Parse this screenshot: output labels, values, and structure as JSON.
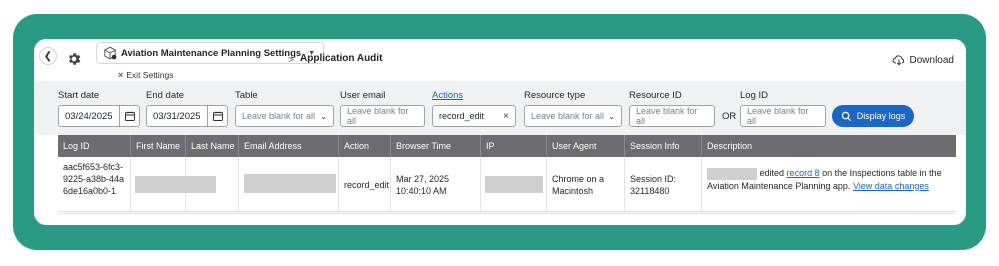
{
  "header": {
    "app_dropdown_label": "Aviation Maintenance Planning Settings",
    "exit_label": "Exit Settings",
    "breadcrumb_sep": ">",
    "page_title": "Application Audit",
    "download_label": "Download"
  },
  "filters": {
    "start_date_label": "Start date",
    "start_date_value": "03/24/2025",
    "end_date_label": "End date",
    "end_date_value": "03/31/2025",
    "table_label": "Table",
    "table_placeholder": "Leave blank for all",
    "user_email_label": "User email",
    "user_email_placeholder": "Leave blank for all",
    "actions_label": "Actions",
    "actions_value": "record_edit",
    "resource_type_label": "Resource type",
    "resource_type_placeholder": "Leave blank for all",
    "resource_id_label": "Resource ID",
    "resource_id_placeholder": "Leave blank for all",
    "or_label": "OR",
    "log_id_label": "Log ID",
    "log_id_placeholder": "Leave blank for all",
    "display_button": "Display logs"
  },
  "table": {
    "columns": [
      "Log ID",
      "First Name",
      "Last Name",
      "Email Address",
      "Action",
      "Browser Time",
      "IP",
      "User Agent",
      "Session Info",
      "Description"
    ],
    "rows": [
      {
        "log_id": "aac5f653-6fc3-9225-a38b-44a6de16a0b0-1",
        "first_name": "",
        "last_name": "",
        "email": "",
        "action": "record_edit",
        "browser_time": "Mar 27, 2025 10:40:10 AM",
        "ip": "",
        "user_agent": "Chrome on a Macintosh",
        "session_info": "Session ID: 32118480",
        "description_pre": "edited",
        "description_link": "record 8",
        "description_mid": "on the Inspections table in the Aviation Maintenance Planning app.",
        "description_link2": "View data changes"
      }
    ]
  },
  "icons": {
    "back": "chevron-left-icon",
    "settings": "gear-icon",
    "app": "app-cube-icon",
    "download": "cloud-download-icon",
    "calendar": "calendar-icon",
    "search": "search-icon"
  },
  "colors": {
    "frame": "#2b9a84",
    "primary": "#1a66c9",
    "table_header": "#6c6c72"
  }
}
